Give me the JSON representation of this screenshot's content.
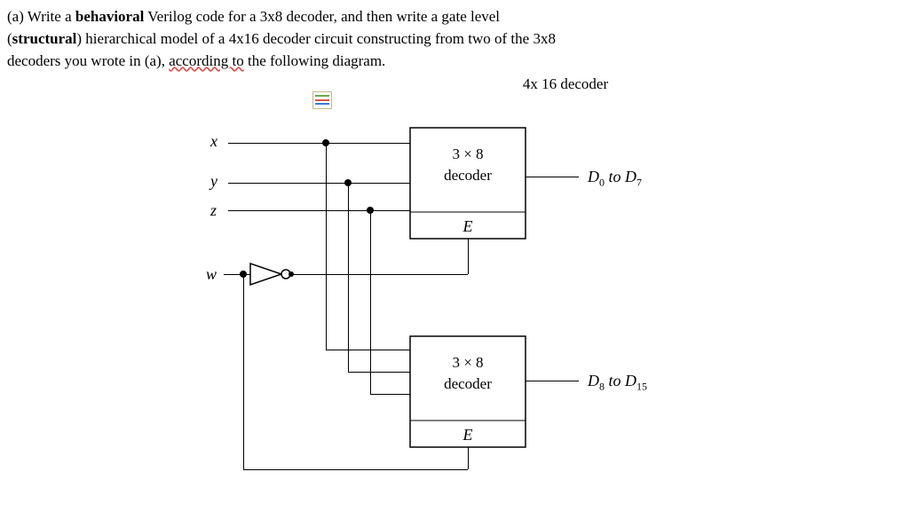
{
  "question": {
    "prefix": "(a) Write a ",
    "bold1": "behavioral",
    "line1_rest": " Verilog code for a 3x8 decoder, and then write a gate level",
    "line2_open": "(",
    "bold2": "structural",
    "line2_rest": ") hierarchical model of a 4x16 decoder circuit constructing from two of the 3x8",
    "line3_a": "decoders you wrote in (a), ",
    "line3_underline": "according to",
    "line3_b": " the following diagram."
  },
  "diagram": {
    "title": "4x 16 decoder",
    "inputs": {
      "x": "x",
      "y": "y",
      "z": "z",
      "w": "w"
    },
    "block": {
      "top": "3 × 8",
      "mid": "decoder",
      "E": "E"
    },
    "outputs": {
      "top_pre": "D",
      "top_sub1": "0",
      "top_mid": " to D",
      "top_sub2": "7",
      "bot_pre": "D",
      "bot_sub1": "8",
      "bot_mid": " to D",
      "bot_sub2": "15"
    }
  },
  "chart_data": {
    "type": "diagram",
    "title": "4x16 decoder built from two 3x8 decoders with enable",
    "inputs": [
      "x",
      "y",
      "z",
      "w"
    ],
    "components": [
      {
        "name": "NOT",
        "type": "inverter",
        "in": "w",
        "out": "w_bar"
      },
      {
        "name": "U_top",
        "type": "3x8 decoder",
        "inputs": [
          "x",
          "y",
          "z"
        ],
        "enable": "w_bar",
        "outputs": "D0..D7"
      },
      {
        "name": "U_bot",
        "type": "3x8 decoder",
        "inputs": [
          "x",
          "y",
          "z"
        ],
        "enable": "w",
        "outputs": "D8..D15"
      }
    ],
    "connections": [
      {
        "from": "x",
        "to": [
          "U_top.in0",
          "U_bot.in0"
        ]
      },
      {
        "from": "y",
        "to": [
          "U_top.in1",
          "U_bot.in1"
        ]
      },
      {
        "from": "z",
        "to": [
          "U_top.in2",
          "U_bot.in2"
        ]
      },
      {
        "from": "w",
        "to": [
          "NOT.in",
          "U_bot.E"
        ]
      },
      {
        "from": "NOT.out",
        "to": [
          "U_top.E"
        ]
      }
    ],
    "outputs": [
      "D0..D7",
      "D8..D15"
    ]
  }
}
